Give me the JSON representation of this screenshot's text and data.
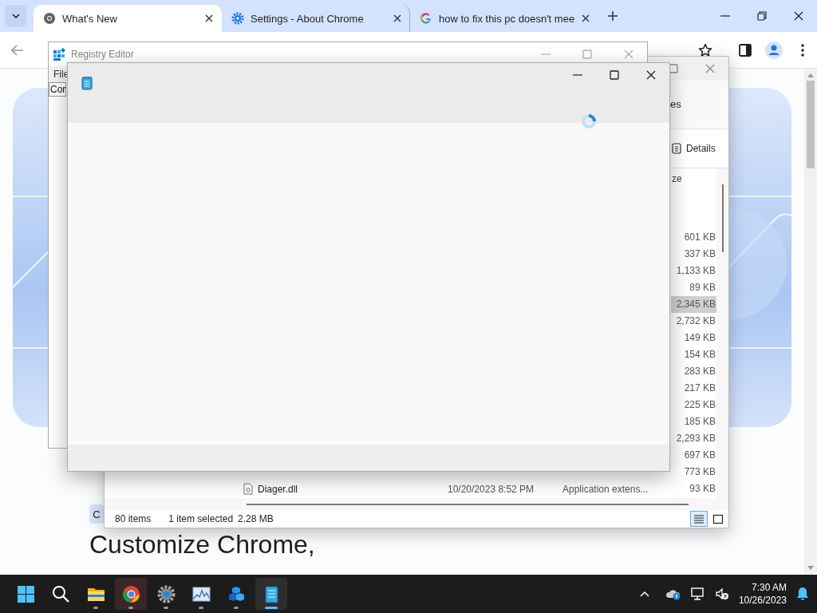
{
  "browser": {
    "tabs": [
      {
        "title": "What's New",
        "kind": "chrome",
        "selected": true
      },
      {
        "title": "Settings - About Chrome",
        "kind": "gear",
        "selected": false
      },
      {
        "title": "how to fix this pc doesn't mee",
        "kind": "google",
        "selected": false
      }
    ],
    "page": {
      "chip": "C",
      "heading": "Customize Chrome,"
    }
  },
  "registry_editor": {
    "title": "Registry Editor",
    "menu": [
      "File"
    ],
    "address": "Cor"
  },
  "explorer": {
    "address_fragment": "es",
    "view_button": "Details",
    "size_column": "ze",
    "rows": [
      {
        "size": "601 KB",
        "selected": false
      },
      {
        "size": "337 KB",
        "selected": false
      },
      {
        "size": "1,133 KB",
        "selected": false
      },
      {
        "size": "89 KB",
        "selected": false
      },
      {
        "size": "2,345 KB",
        "selected": true
      },
      {
        "size": "2,732 KB",
        "selected": false
      },
      {
        "size": "149 KB",
        "selected": false
      },
      {
        "size": "154 KB",
        "selected": false
      },
      {
        "size": "283 KB",
        "selected": false
      },
      {
        "size": "217 KB",
        "selected": false
      },
      {
        "size": "225 KB",
        "selected": false
      },
      {
        "size": "185 KB",
        "selected": false
      },
      {
        "size": "2,293 KB",
        "selected": false
      },
      {
        "size": "697 KB",
        "selected": false
      },
      {
        "size": "773 KB",
        "selected": false
      },
      {
        "name": "Diager.dll",
        "modified": "10/20/2023 8:52 PM",
        "type": "Application extens...",
        "size": "93 KB",
        "selected": false
      }
    ],
    "status": {
      "count": "80 items",
      "selection": "1 item selected",
      "selection_size": "2.28 MB"
    },
    "views": [
      {
        "kind": "details",
        "selected": true
      },
      {
        "kind": "tiles",
        "selected": false
      }
    ]
  },
  "notepad": {
    "loading": true
  },
  "taskbar": {
    "apps": [
      {
        "kind": "start",
        "running": false,
        "selected": false
      },
      {
        "kind": "search",
        "running": false,
        "selected": false
      },
      {
        "kind": "files",
        "running": true,
        "selected": false
      },
      {
        "kind": "browser",
        "running": true,
        "selected": false,
        "highlighted": true
      },
      {
        "kind": "settings",
        "running": true,
        "selected": false
      },
      {
        "kind": "monitor",
        "running": true,
        "selected": false
      },
      {
        "kind": "cubes",
        "running": true,
        "selected": false
      },
      {
        "kind": "notepad",
        "running": true,
        "selected": true
      }
    ],
    "time": "7:30 AM",
    "date": "10/26/2023"
  }
}
